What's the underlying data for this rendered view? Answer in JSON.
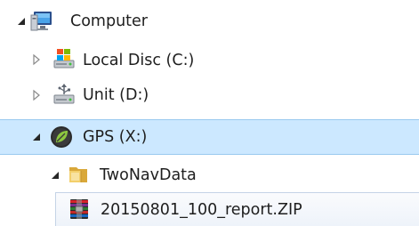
{
  "tree": {
    "items": [
      {
        "label": "Computer",
        "icon": "computer-icon",
        "expander": "expanded"
      },
      {
        "label": "Local Disc (C:)",
        "icon": "windows-drive-icon",
        "expander": "collapsed"
      },
      {
        "label": "Unit (D:)",
        "icon": "usb-drive-icon",
        "expander": "collapsed"
      },
      {
        "label": "GPS (X:)",
        "icon": "gps-drive-icon",
        "expander": "expanded",
        "state": "selected"
      },
      {
        "label": "TwoNavData",
        "icon": "folder-icon",
        "expander": "expanded"
      },
      {
        "label": "20150801_100_report.ZIP",
        "icon": "zip-archive-icon",
        "state": "hover"
      }
    ]
  },
  "colors": {
    "selection_bg": "#cce8ff",
    "selection_border": "#99c9ef",
    "text": "#1e1e1e"
  }
}
